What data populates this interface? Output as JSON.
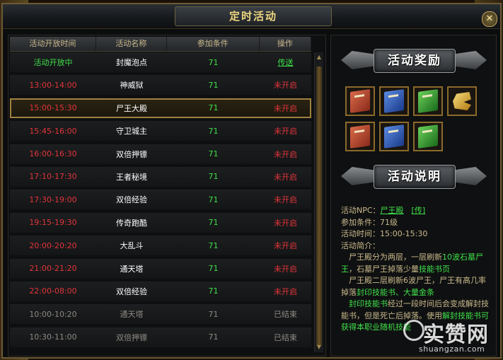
{
  "window": {
    "title": "定时活动",
    "close_label": "✕"
  },
  "table": {
    "columns": [
      "活动开放时间",
      "活动名称",
      "参加条件",
      "操作"
    ],
    "rows": [
      {
        "time": "活动开放中",
        "name": "封魔泡点",
        "cond": "71",
        "action": "传送",
        "state": "open"
      },
      {
        "time": "13:00-14:00",
        "name": "神威狱",
        "cond": "71",
        "action": "未开启",
        "state": "pending"
      },
      {
        "time": "15:00-15:30",
        "name": "尸王大殿",
        "cond": "71",
        "action": "未开启",
        "state": "selected"
      },
      {
        "time": "15:45-16:00",
        "name": "守卫城主",
        "cond": "71",
        "action": "未开启",
        "state": "pending"
      },
      {
        "time": "16:00-16:30",
        "name": "双倍押镖",
        "cond": "71",
        "action": "未开启",
        "state": "pending"
      },
      {
        "time": "17:10-17:30",
        "name": "王者秘境",
        "cond": "71",
        "action": "未开启",
        "state": "pending"
      },
      {
        "time": "17:30-19:00",
        "name": "双倍经验",
        "cond": "71",
        "action": "未开启",
        "state": "pending"
      },
      {
        "time": "19:15-19:30",
        "name": "传奇跑酷",
        "cond": "71",
        "action": "未开启",
        "state": "pending"
      },
      {
        "time": "20:00-20:20",
        "name": "大乱斗",
        "cond": "71",
        "action": "未开启",
        "state": "pending"
      },
      {
        "time": "21:00-21:20",
        "name": "通天塔",
        "cond": "71",
        "action": "未开启",
        "state": "pending"
      },
      {
        "time": "22:00-08:00",
        "name": "双倍经验",
        "cond": "71",
        "action": "未开启",
        "state": "pending"
      },
      {
        "time": "10:00-10:20",
        "name": "通天塔",
        "cond": "71",
        "action": "已结束",
        "state": "ended"
      },
      {
        "time": "10:30-11:00",
        "name": "双倍押镖",
        "cond": "71",
        "action": "已结束",
        "state": "ended"
      }
    ]
  },
  "rewards": {
    "banner": "活动奖励",
    "items": [
      {
        "icon": "red-skill-book-icon"
      },
      {
        "icon": "blue-skill-book-icon"
      },
      {
        "icon": "green-skill-book-icon"
      },
      {
        "icon": "gold-ingot-icon"
      },
      {
        "icon": "red-skill-book-icon"
      },
      {
        "icon": "blue-skill-book-icon"
      },
      {
        "icon": "green-skill-book-icon"
      }
    ]
  },
  "description": {
    "banner": "活动说明",
    "npc_label": "活动NPC：",
    "npc_value": "尸王殿",
    "npc_teleport": "[传]",
    "cond_label": "参加条件：",
    "cond_value": "71级",
    "time_label": "活动时间：",
    "time_value": "15:00-15:30",
    "intro_label": "活动简介：",
    "p1_a": "　尸王殿分为两层，一层刷新",
    "p1_b": "10波石墓尸王",
    "p1_c": "，石墓尸王掉落少量",
    "p1_d": "技能书页",
    "p2_a": "　尸王殿二层刷新6波尸王，尸王有高几率掉落",
    "p2_b": "封印技能书、大量金条",
    "p3_a": "　封印技能书",
    "p3_b": "经过一段时间后会变成解封技能书，但是死亡后掉落。使用",
    "p3_c": "解封技能书可获得本职业随机技能"
  },
  "watermark": {
    "big": "实赞网",
    "small": "shuangzan.com"
  },
  "colors": {
    "open": "#3fe04a",
    "pending": "#e2353a",
    "ended": "#8e8a82",
    "gold": "#f0d680"
  }
}
